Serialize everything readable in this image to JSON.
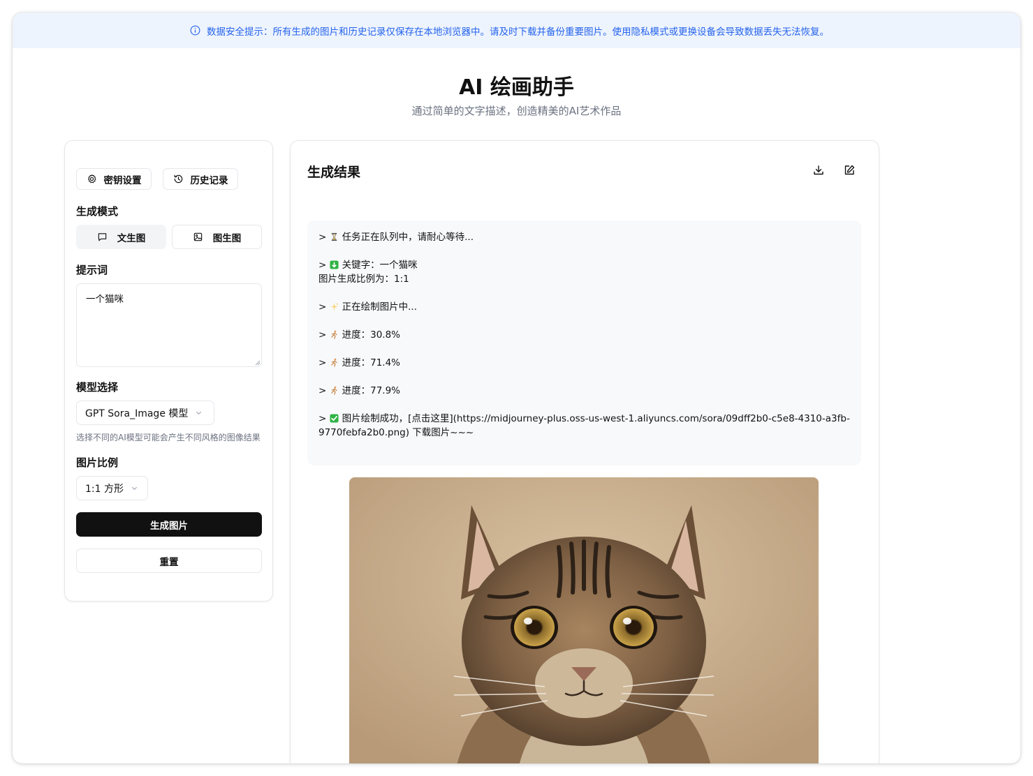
{
  "notice": {
    "text": "数据安全提示：所有生成的图片和历史记录仅保存在本地浏览器中。请及时下载并备份重要图片。使用隐私模式或更换设备会导致数据丢失无法恢复。"
  },
  "header": {
    "title": "AI 绘画助手",
    "subtitle": "通过简单的文字描述，创造精美的AI艺术作品"
  },
  "sidebar": {
    "key_settings_label": "密钥设置",
    "history_label": "历史记录",
    "mode_section_label": "生成模式",
    "modes": [
      {
        "label": "文生图",
        "active": true
      },
      {
        "label": "图生图",
        "active": false
      }
    ],
    "prompt_section_label": "提示词",
    "prompt_value": "一个猫咪",
    "model_section_label": "模型选择",
    "model_selected": "GPT Sora_Image 模型",
    "model_hint": "选择不同的AI模型可能会产生不同风格的图像结果",
    "ratio_section_label": "图片比例",
    "ratio_selected": "1:1 方形",
    "generate_label": "生成图片",
    "reset_label": "重置"
  },
  "result": {
    "title": "生成结果",
    "log": [
      "任务正在队列中，请耐心等待...",
      "关键字：一个猫咪",
      "图片生成比例为：1:1",
      "正在绘制图片中...",
      "进度：30.8%",
      "进度：71.4%",
      "进度：77.9%",
      "图片绘制成功，[点击这里](https://midjourney-plus.oss-us-west-1.aliyuncs.com/sora/09dff2b0-c5e8-4310-a3fb-9770febfa2b0.png) 下载图片~~~"
    ],
    "log_prefix": "> "
  },
  "colors": {
    "accent": "#2563eb",
    "notice_bg": "#eef4fe",
    "primary_button": "#111111"
  },
  "icons": {
    "notice": "info-icon",
    "key_settings": "gear-icon",
    "history": "history-icon",
    "text_mode": "message-icon",
    "image_mode": "image-icon",
    "download": "download-icon",
    "edit": "edit-icon",
    "queue": "hourglass-icon",
    "keyword": "arrow-down-box-icon",
    "drawing": "sparkles-icon",
    "progress": "running-icon",
    "success": "check-box-icon"
  }
}
